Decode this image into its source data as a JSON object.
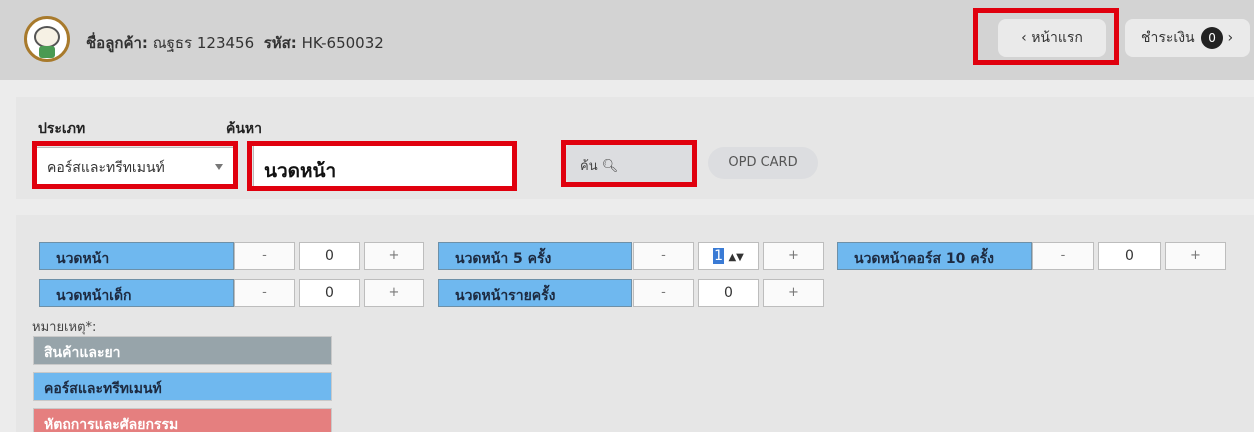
{
  "header": {
    "customer_label": "ชื่อลูกค้า:",
    "customer_name": "ณฐธร 123456",
    "code_label": "รหัส:",
    "code_value": "HK-650032",
    "home_button": "หน้าแรก",
    "home_icon": "chevron-left-icon",
    "pay_button": "ชำระเงิน",
    "pay_count": "0",
    "pay_icon": "chevron-right-icon"
  },
  "search": {
    "type_label": "ประเภท",
    "type_value": "คอร์สและทรีทเมนท์",
    "query_label": "ค้นหา",
    "query_value": "นวดหน้า",
    "search_button": "ค้น",
    "search_icon": "magnifier-icon",
    "opd_button": "OPD CARD"
  },
  "items": [
    {
      "name": "นวดหน้า",
      "qty": "0"
    },
    {
      "name": "นวดหน้า 5 ครั้ง",
      "qty": "1"
    },
    {
      "name": "นวดหน้าคอร์ส 10 ครั้ง",
      "qty": "0"
    },
    {
      "name": "นวดหน้าเด็ก",
      "qty": "0"
    },
    {
      "name": "นวดหน้ารายครั้ง",
      "qty": "0"
    }
  ],
  "stepper": {
    "minus": "-",
    "plus": "+"
  },
  "notes": {
    "label": "หมายเหตุ*:",
    "legend": [
      {
        "label": "สินค้าและยา",
        "color": "#97a4aa"
      },
      {
        "label": "คอร์สและทรีทเมนท์",
        "color": "#6fb8ef"
      },
      {
        "label": "หัตถการและศัลยกรรม",
        "color": "#e57f7f"
      }
    ]
  },
  "colors": {
    "highlight": "#e0000e",
    "course": "#6fb8ef"
  }
}
